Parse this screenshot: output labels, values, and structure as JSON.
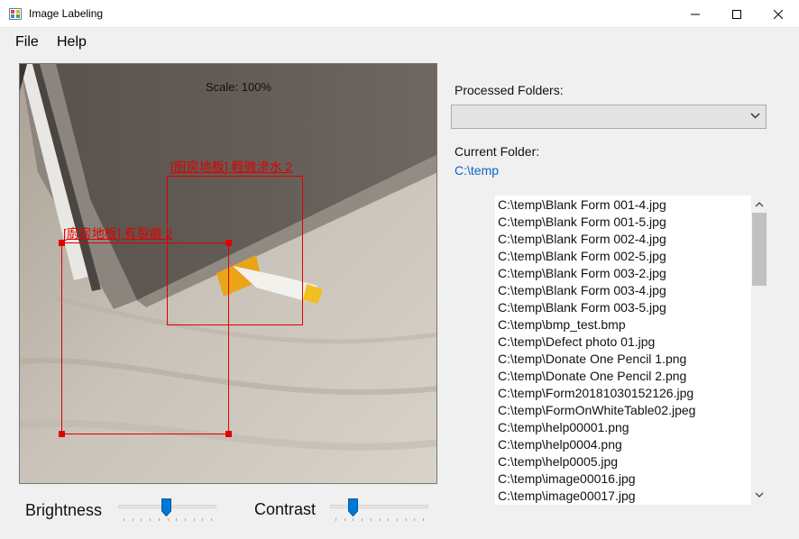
{
  "window": {
    "title": "Image Labeling",
    "icon": "app-icon",
    "controls": [
      "minimize-icon",
      "maximize-icon",
      "close-icon"
    ]
  },
  "menu": {
    "items": [
      "File",
      "Help"
    ]
  },
  "canvas": {
    "scale_text": "Scale: 100%",
    "boxes": [
      {
        "label": "[廚房地板] 輕微滲水 2"
      },
      {
        "label": "[廚房地板] 有裂痕 2"
      }
    ]
  },
  "sliders": {
    "brightness_label": "Brightness",
    "brightness_value": 0.5,
    "contrast_label": "Contrast",
    "contrast_value": 0.2
  },
  "panel": {
    "processed_label": "Processed Folders:",
    "processed_selected": "",
    "current_label": "Current Folder:",
    "current_path": "C:\\temp"
  },
  "files": [
    "C:\\temp\\Blank Form 001-4.jpg",
    "C:\\temp\\Blank Form 001-5.jpg",
    "C:\\temp\\Blank Form 002-4.jpg",
    "C:\\temp\\Blank Form 002-5.jpg",
    "C:\\temp\\Blank Form 003-2.jpg",
    "C:\\temp\\Blank Form 003-4.jpg",
    "C:\\temp\\Blank Form 003-5.jpg",
    "C:\\temp\\bmp_test.bmp",
    "C:\\temp\\Defect photo 01.jpg",
    "C:\\temp\\Donate One Pencil 1.png",
    "C:\\temp\\Donate One Pencil 2.png",
    "C:\\temp\\Form20181030152126.jpg",
    "C:\\temp\\FormOnWhiteTable02.jpeg",
    "C:\\temp\\help00001.png",
    "C:\\temp\\help0004.png",
    "C:\\temp\\help0005.jpg",
    "C:\\temp\\image00016.jpg",
    "C:\\temp\\image00017.jpg"
  ]
}
